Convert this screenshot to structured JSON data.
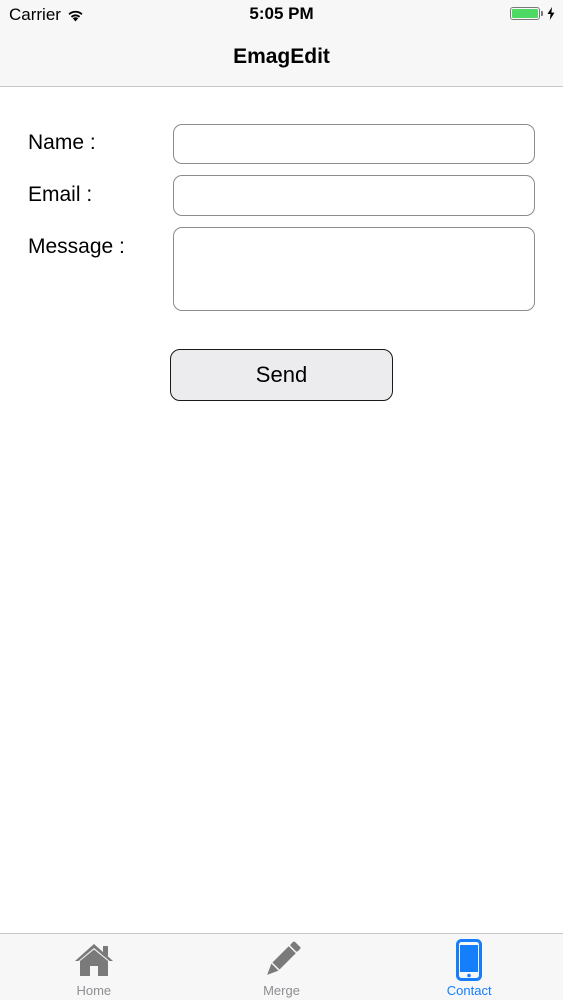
{
  "status_bar": {
    "carrier": "Carrier",
    "time": "5:05 PM",
    "battery_color": "#4cd964"
  },
  "nav": {
    "title": "EmagEdit"
  },
  "form": {
    "name_label": "Name :",
    "email_label": "Email :",
    "message_label": "Message :",
    "name_value": "",
    "email_value": "",
    "message_value": "",
    "send_label": "Send"
  },
  "tabbar": {
    "active_color": "#147efb",
    "inactive_color": "#8e8e93",
    "items": [
      {
        "label": "Home",
        "icon": "home-icon"
      },
      {
        "label": "Merge",
        "icon": "pencil-icon"
      },
      {
        "label": "Contact",
        "icon": "phone-icon"
      }
    ]
  }
}
